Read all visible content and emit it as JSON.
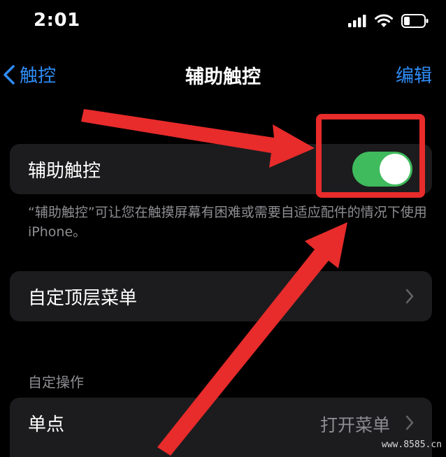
{
  "status_bar": {
    "time": "2:01",
    "icons": [
      "cellular-signal-icon",
      "wifi-icon",
      "battery-icon"
    ]
  },
  "nav": {
    "back_label": "触控",
    "title": "辅助触控",
    "edit_label": "编辑"
  },
  "assistive_touch": {
    "label": "辅助触控",
    "enabled": true,
    "footnote": "“辅助触控”可让您在触摸屏幕有困难或需要自适应配件的情况下使用iPhone。"
  },
  "top_menu": {
    "label": "自定顶层菜单"
  },
  "custom_actions": {
    "header": "自定操作",
    "rows": [
      {
        "label": "单点",
        "value": "打开菜单"
      }
    ]
  },
  "watermark": "www.8585.cn",
  "colors": {
    "accent_blue": "#2f8df7",
    "toggle_on": "#3fba5c",
    "annotation_red": "#e82b2b",
    "cell_background": "#1c1c1e"
  }
}
